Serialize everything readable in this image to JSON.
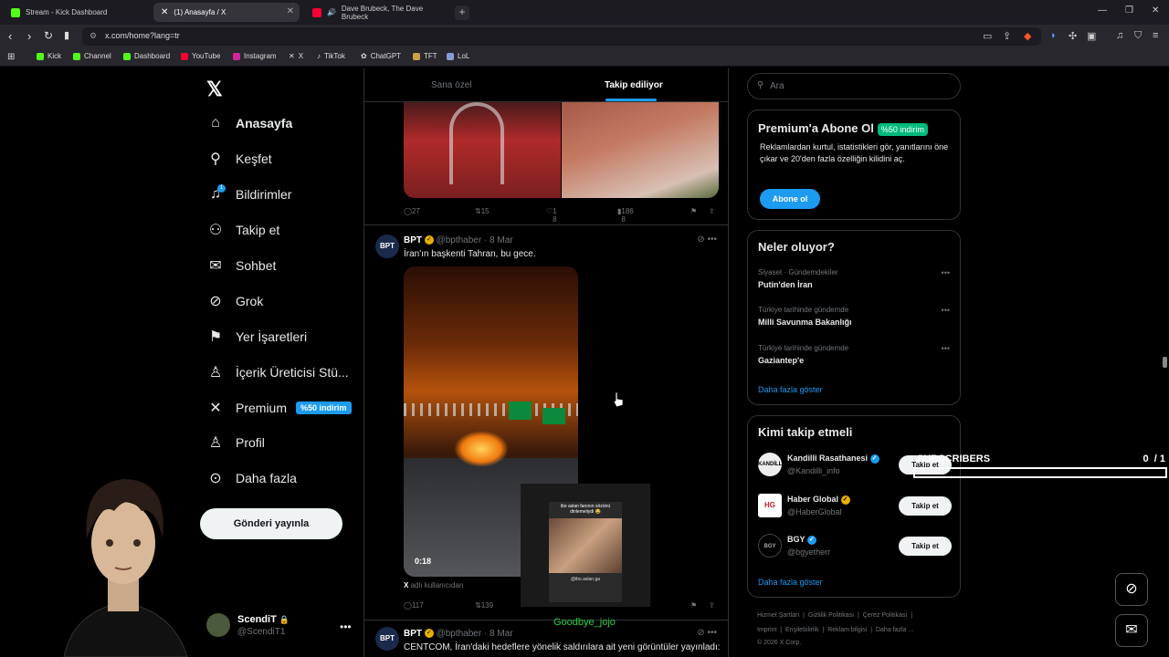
{
  "browser": {
    "tabs": [
      {
        "title": "Stream - Kick Dashboard",
        "icon": "kick-icon",
        "color": "#53fc18"
      },
      {
        "title": "(1) Anasayfa / X",
        "icon": "x-icon",
        "color": "#ffffff"
      },
      {
        "title": "Dave Brubeck, The Dave Brubeck",
        "icon": "youtube-icon",
        "color": "#ff0033"
      }
    ],
    "url": "x.com/home?lang=tr",
    "bookmarks": [
      {
        "label": "Kick",
        "color": "#53fc18"
      },
      {
        "label": "Channel",
        "color": "#53fc18"
      },
      {
        "label": "Dashboard",
        "color": "#53fc18"
      },
      {
        "label": "YouTube",
        "color": "#ff0033"
      },
      {
        "label": "Instagram",
        "color": "#d6249f"
      },
      {
        "label": "X",
        "color": "#ffffff"
      },
      {
        "label": "TikTok",
        "color": "#ffffff"
      },
      {
        "label": "ChatGPT",
        "color": "#cccccc"
      },
      {
        "label": "TFT",
        "color": "#c8a24a"
      },
      {
        "label": "LoL",
        "color": "#8a9ad8"
      }
    ]
  },
  "nav": {
    "items": [
      {
        "label": "Anasayfa",
        "icon": "home-icon"
      },
      {
        "label": "Keşfet",
        "icon": "search-icon"
      },
      {
        "label": "Bildirimler",
        "icon": "bell-icon",
        "badge": "1"
      },
      {
        "label": "Takip et",
        "icon": "person-add-icon"
      },
      {
        "label": "Sohbet",
        "icon": "mail-icon"
      },
      {
        "label": "Grok",
        "icon": "grok-icon"
      },
      {
        "label": "Yer İşaretleri",
        "icon": "bookmark-icon"
      },
      {
        "label": "İçerik Üreticisi Stü...",
        "icon": "creator-icon"
      },
      {
        "label": "Premium",
        "icon": "x-icon",
        "badge": "%50 indirim"
      },
      {
        "label": "Profil",
        "icon": "profile-icon"
      },
      {
        "label": "Daha fazla",
        "icon": "more-circle-icon"
      }
    ],
    "post_button": "Gönderi yayınla",
    "profile": {
      "name": "ScendiT",
      "handle": "@ScendiT1"
    }
  },
  "feed": {
    "tabs": [
      "Sana özel",
      "Takip ediliyor"
    ],
    "active_tab": 1,
    "tweet1_actions": {
      "replies": "27",
      "retweets": "15",
      "likes": "1 8",
      "views": "186 8"
    },
    "tweet2": {
      "name": "BPT",
      "handle": "@bpthaber",
      "date": "8 Mar",
      "text": "İran'ın başkenti Tahran, bu gece.",
      "video_duration": "0:18",
      "source_prefix": "X",
      "source_label": "adlı kullanıcıdan",
      "actions": {
        "replies": "117",
        "retweets": "139"
      }
    },
    "tweet3": {
      "name": "BPT",
      "handle": "@bpthaber",
      "date": "8 Mar",
      "text": "CENTCOM, İran'daki hedeflere yönelik saldırılara ait yeni görüntüler yayınladı:"
    }
  },
  "overlay": {
    "goodbye": "Goodbye_jojo",
    "pip_top": "ibo aslan fanının sözünü dinlemeliydi 😂",
    "pip_bottom": "@ibo.aslan.ga",
    "subscribers_label": "SUBSCRIBERS",
    "subscribers_count": "0",
    "subscribers_goal": "/ 1",
    "subscribers_progress": 0
  },
  "right": {
    "search_placeholder": "Ara",
    "premium": {
      "title": "Premium'a Abone Ol",
      "badge": "%50 indirim",
      "desc": "Reklamlardan kurtul, istatistikleri gör, yanıtlarını öne çıkar ve 20'den fazla özelliğin kilidini aç.",
      "button": "Abone ol"
    },
    "trends": {
      "title": "Neler oluyor?",
      "items": [
        {
          "context": "Siyaset · Gündemdekiler",
          "topic": "Putin'den İran"
        },
        {
          "context": "Türkiye tarihinde gündemde",
          "topic": "Milli Savunma Bakanlığı"
        },
        {
          "context": "Türkiye tarihinde gündemde",
          "topic": "Gaziantep'e"
        }
      ],
      "show_more": "Daha fazla göster"
    },
    "who_to_follow": {
      "title": "Kimi takip etmeli",
      "items": [
        {
          "name": "Kandilli Rasathanesi",
          "handle": "@Kandilli_info",
          "avatar": "KANDİLLİ",
          "button": "Takip et",
          "verified": "blue"
        },
        {
          "name": "Haber Global",
          "handle": "@HaberGlobal",
          "avatar": "HG",
          "button": "Takip et",
          "verified": "gold"
        },
        {
          "name": "BGY",
          "handle": "@bgyetherr",
          "avatar": "BGY",
          "button": "Takip et",
          "verified": "blue"
        }
      ],
      "show_more": "Daha fazla göster"
    },
    "footer": {
      "line1": [
        "Hizmet Şartları",
        "Gizlilik Politikası",
        "Çerez Politikası"
      ],
      "line2": [
        "Imprint",
        "Erişilebilirlik",
        "Reklam bilgisi",
        "Daha fazla ..."
      ],
      "copyright": "© 2026 X Corp."
    }
  }
}
